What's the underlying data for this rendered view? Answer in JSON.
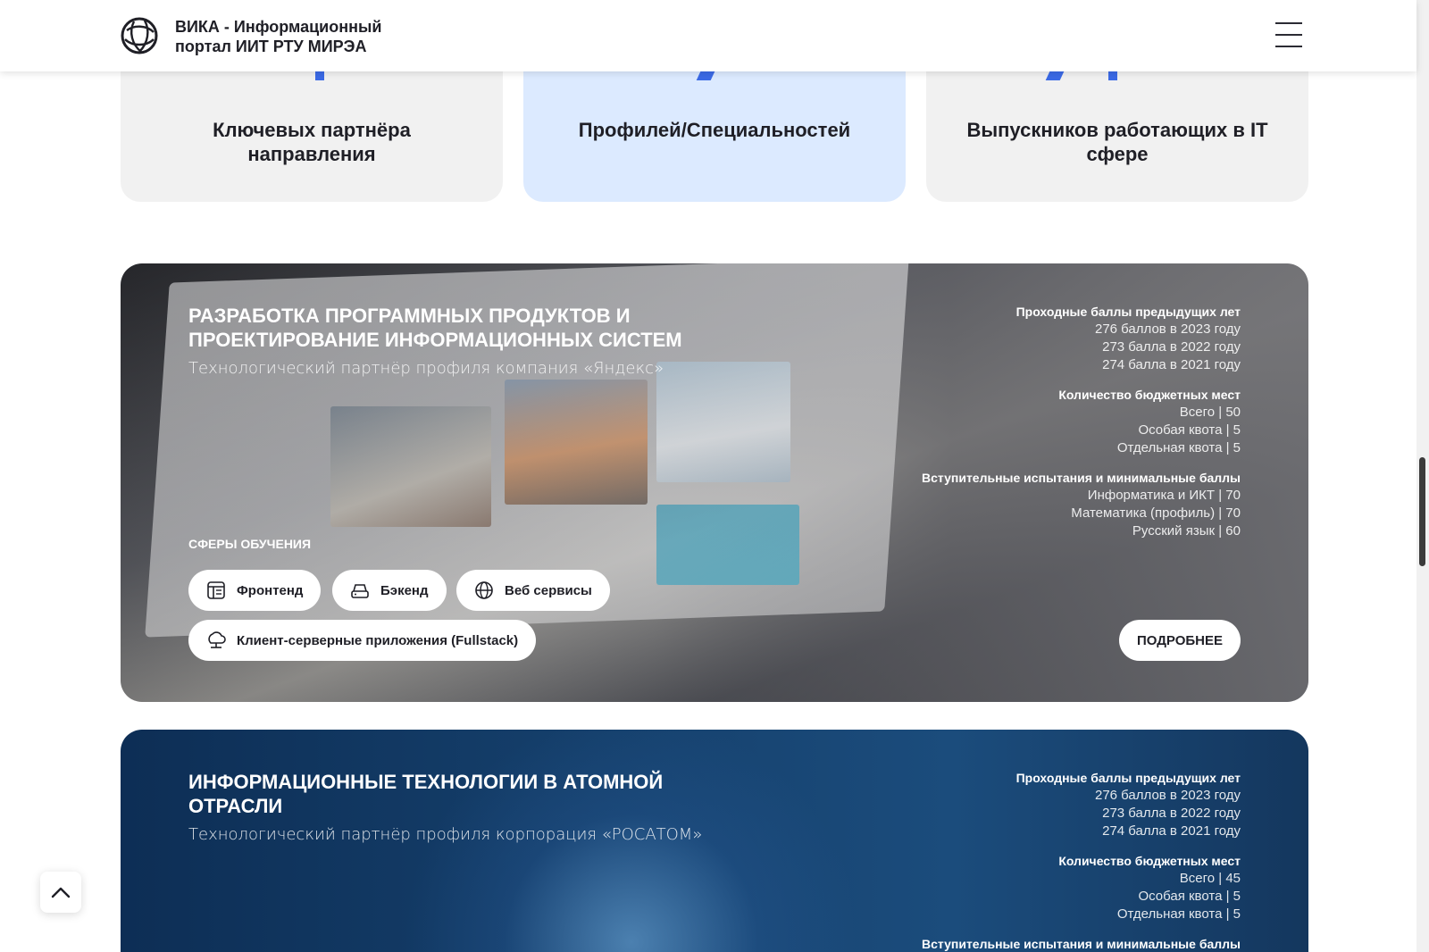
{
  "header": {
    "brand_line1": "ВИКА - Информационный",
    "brand_line2": "портал ИИТ РТУ МИРЭА",
    "logo_icon": "globe-network-icon",
    "menu_icon": "hamburger-menu-icon"
  },
  "stats": [
    {
      "label": "Ключевых партнёра направления",
      "active": false
    },
    {
      "label": "Профилей/Специальностей",
      "active": true
    },
    {
      "label": "Выпускников работающих в IT сфере",
      "active": false
    }
  ],
  "programs": [
    {
      "title": "Разработка программных продуктов и проектирование информационных систем",
      "subtitle": "Технологический партнёр профиля компания «Яндекс»",
      "scores_title": "Проходные баллы предыдущих лет",
      "scores": [
        "276 баллов в 2023 году",
        "273 балла в 2022 году",
        "274 балла в 2021 году"
      ],
      "budget_title": "Количество бюджетных мест",
      "budget": [
        "Всего | 50",
        "Особая квота | 5",
        "Отдельная квота | 5"
      ],
      "exams_title": "Вступительные испытания и минимальные баллы",
      "exams": [
        "Информатика и ИКТ | 70",
        "Математика (профиль) | 70",
        "Русский язык | 60"
      ],
      "spheres_title": "СФЕРЫ ОБУЧЕНИЯ",
      "spheres": [
        {
          "label": "Фронтенд",
          "icon": "layout-icon"
        },
        {
          "label": "Бэкенд",
          "icon": "server-icon"
        },
        {
          "label": "Веб сервисы",
          "icon": "globe-icon"
        },
        {
          "label": "Клиент-серверные приложения (Fullstack)",
          "icon": "client-server-icon"
        }
      ],
      "more_label": "Подробнее"
    },
    {
      "title": "Информационные технологии в атомной отрасли",
      "subtitle": "Технологический партнёр профиля корпорация «РОСАТОМ»",
      "scores_title": "Проходные баллы предыдущих лет",
      "scores": [
        "276 баллов в 2023 году",
        "273 балла в 2022 году",
        "274 балла в 2021 году"
      ],
      "budget_title": "Количество бюджетных мест",
      "budget": [
        "Всего | 45",
        "Особая квота | 5",
        "Отдельная квота | 5"
      ],
      "exams_title": "Вступительные испытания и минимальные баллы"
    }
  ],
  "colors": {
    "accent": "#3b6ae6",
    "card_bg": "#f1f1f1",
    "active_card_bg": "#dceaff"
  },
  "scroll_top_icon": "chevron-up-icon"
}
